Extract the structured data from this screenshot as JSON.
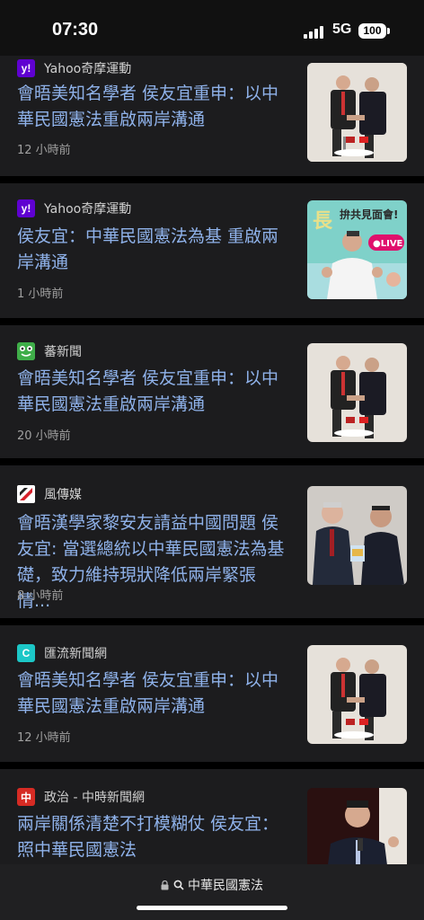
{
  "status": {
    "time": "07:30",
    "network": "5G",
    "battery": "100"
  },
  "articles": [
    {
      "source": "Yahoo奇摩運動",
      "logo": "y!",
      "logo_color": "#5f01d1",
      "headline": "會晤美知名學者 侯友宜重申：以中華民國憲法重啟兩岸溝通",
      "time": "12 小時前"
    },
    {
      "source": "Yahoo奇摩運動",
      "logo": "y!",
      "logo_color": "#5f01d1",
      "headline": "侯友宜：中華民國憲法為基 重啟兩岸溝通",
      "time": "1 小時前"
    },
    {
      "source": "蕃新聞",
      "logo": "frog-icon",
      "logo_color": "#3fae49",
      "headline": "會晤美知名學者 侯友宜重申：以中華民國憲法重啟兩岸溝通",
      "time": "20 小時前"
    },
    {
      "source": "風傳媒",
      "logo": "storm-icon",
      "logo_color": "#ffffff",
      "headline": "會晤漢學家黎安友請益中國問題 侯友宜: 當選總統以中華民國憲法為基礎，致力維持現狀降低兩岸緊張情...",
      "time": "8 小時前"
    },
    {
      "source": "匯流新聞網",
      "logo": "C",
      "logo_color": "#1cc7c7",
      "headline": "會晤美知名學者 侯友宜重申：以中華民國憲法重啟兩岸溝通",
      "time": "12 小時前"
    },
    {
      "source": "政治 - 中時新聞網",
      "logo": "中",
      "logo_color": "#d62b24",
      "headline": "兩岸關係清楚不打模糊仗 侯友宜：照中華民國憲法",
      "time": ""
    }
  ],
  "search": {
    "query": "中華民國憲法"
  },
  "stream_badge": "●LIVE",
  "stream_title": "拚共見面會!"
}
